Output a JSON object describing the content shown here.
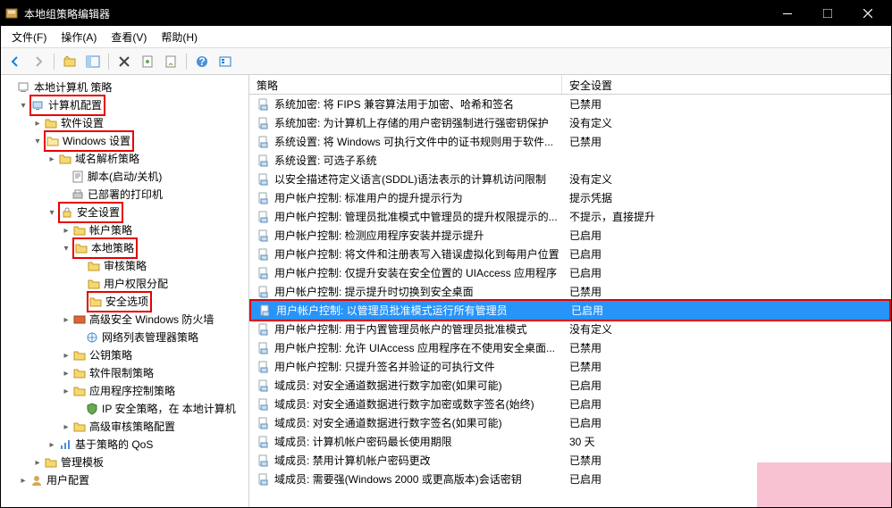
{
  "window": {
    "title": "本地组策略编辑器"
  },
  "menu": {
    "file": "文件(F)",
    "action": "操作(A)",
    "view": "查看(V)",
    "help": "帮助(H)"
  },
  "tree": {
    "root": "本地计算机 策略",
    "computer_config": "计算机配置",
    "software_settings": "软件设置",
    "windows_settings": "Windows 设置",
    "dns": "域名解析策略",
    "scripts": "脚本(启动/关机)",
    "printers": "已部署的打印机",
    "security_settings": "安全设置",
    "account_policies": "帐户策略",
    "local_policies": "本地策略",
    "audit": "审核策略",
    "user_rights": "用户权限分配",
    "security_options": "安全选项",
    "firewall": "高级安全 Windows 防火墙",
    "nlm": "网络列表管理器策略",
    "public_key": "公钥策略",
    "software_restriction": "软件限制策略",
    "app_control": "应用程序控制策略",
    "ip_security": "IP 安全策略，在 本地计算机",
    "advanced_audit": "高级审核策略配置",
    "qos": "基于策略的 QoS",
    "admin_templates": "管理模板",
    "user_config": "用户配置"
  },
  "columns": {
    "policy": "策略",
    "setting": "安全设置"
  },
  "rows": [
    {
      "name": "系统加密: 将 FIPS 兼容算法用于加密、哈希和签名",
      "value": "已禁用"
    },
    {
      "name": "系统加密: 为计算机上存储的用户密钥强制进行强密钥保护",
      "value": "没有定义"
    },
    {
      "name": "系统设置: 将 Windows 可执行文件中的证书规则用于软件...",
      "value": "已禁用"
    },
    {
      "name": "系统设置: 可选子系统",
      "value": ""
    },
    {
      "name": "以安全描述符定义语言(SDDL)语法表示的计算机访问限制",
      "value": "没有定义"
    },
    {
      "name": "用户帐户控制: 标准用户的提升提示行为",
      "value": "提示凭据"
    },
    {
      "name": "用户帐户控制: 管理员批准模式中管理员的提升权限提示的...",
      "value": "不提示，直接提升"
    },
    {
      "name": "用户帐户控制: 检测应用程序安装并提示提升",
      "value": "已启用"
    },
    {
      "name": "用户帐户控制: 将文件和注册表写入错误虚拟化到每用户位置",
      "value": "已启用"
    },
    {
      "name": "用户帐户控制: 仅提升安装在安全位置的 UIAccess 应用程序",
      "value": "已启用"
    },
    {
      "name": "用户帐户控制: 提示提升时切换到安全桌面",
      "value": "已禁用"
    },
    {
      "name": "用户帐户控制: 以管理员批准模式运行所有管理员",
      "value": "已启用",
      "selected": true
    },
    {
      "name": "用户帐户控制: 用于内置管理员帐户的管理员批准模式",
      "value": "没有定义"
    },
    {
      "name": "用户帐户控制: 允许 UIAccess 应用程序在不使用安全桌面...",
      "value": "已禁用"
    },
    {
      "name": "用户帐户控制: 只提升签名并验证的可执行文件",
      "value": "已禁用"
    },
    {
      "name": "域成员: 对安全通道数据进行数字加密(如果可能)",
      "value": "已启用"
    },
    {
      "name": "域成员: 对安全通道数据进行数字加密或数字签名(始终)",
      "value": "已启用"
    },
    {
      "name": "域成员: 对安全通道数据进行数字签名(如果可能)",
      "value": "已启用"
    },
    {
      "name": "域成员: 计算机帐户密码最长使用期限",
      "value": "30 天"
    },
    {
      "name": "域成员: 禁用计算机帐户密码更改",
      "value": "已禁用"
    },
    {
      "name": "域成员: 需要强(Windows 2000 或更高版本)会话密钥",
      "value": "已启用"
    }
  ]
}
